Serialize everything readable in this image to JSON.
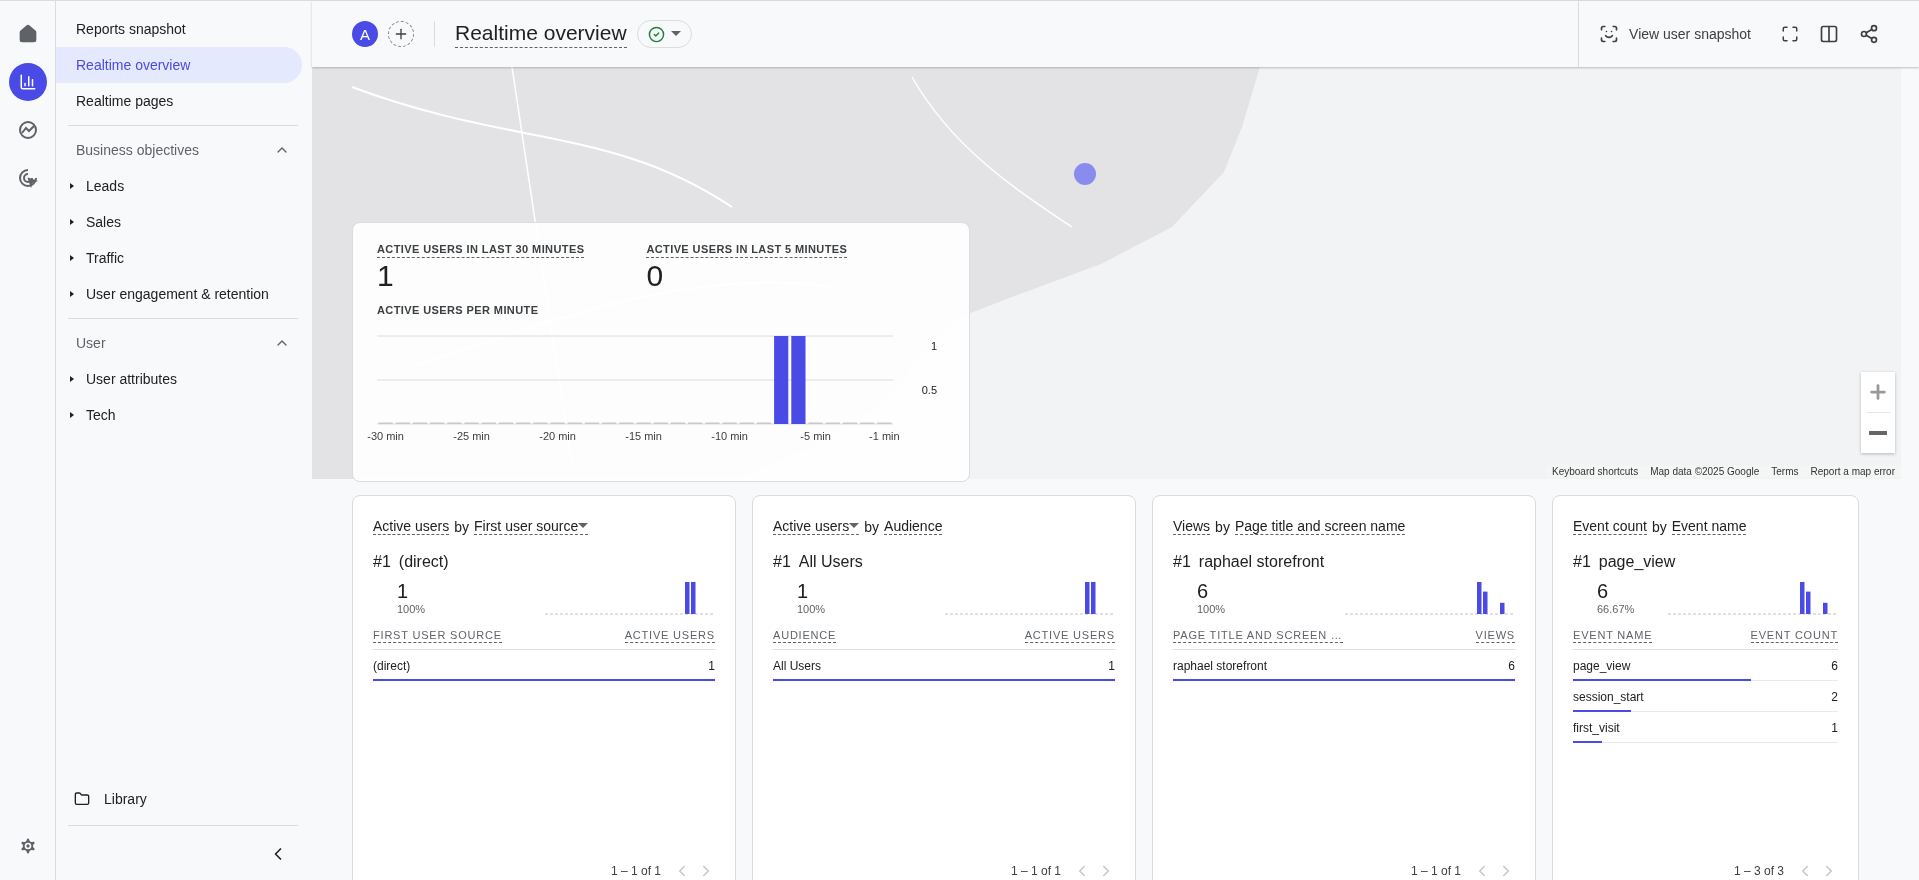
{
  "rail": {
    "items": [
      {
        "kind": "home",
        "selected": false
      },
      {
        "kind": "reports",
        "selected": true
      },
      {
        "kind": "explore",
        "selected": false
      },
      {
        "kind": "advertising",
        "selected": false
      }
    ]
  },
  "sidebar": {
    "items": [
      {
        "label": "Reports snapshot",
        "selected": false
      },
      {
        "label": "Realtime overview",
        "selected": true
      },
      {
        "label": "Realtime pages",
        "selected": false
      }
    ],
    "sections": [
      {
        "title": "Business objectives",
        "expanded": true,
        "children": [
          {
            "label": "Leads",
            "expanded": false
          },
          {
            "label": "Sales",
            "expanded": false
          },
          {
            "label": "Traffic",
            "expanded": false
          },
          {
            "label": "User engagement & retention",
            "expanded": false
          }
        ]
      },
      {
        "title": "User",
        "expanded": true,
        "children": [
          {
            "label": "User attributes",
            "expanded": false
          },
          {
            "label": "Tech",
            "expanded": false
          }
        ]
      }
    ],
    "library": "Library"
  },
  "header": {
    "avatar": "A",
    "title": "Realtime overview",
    "snapshot_button": "View user snapshot"
  },
  "map": {
    "kind": "picture",
    "attribution": [
      "Keyboard shortcuts",
      "Map data ©2025 Google",
      "Terms",
      "Report a map error"
    ]
  },
  "summary": {
    "metrics": [
      {
        "label": "ACTIVE USERS IN LAST 30 MINUTES",
        "value": "1"
      },
      {
        "label": "ACTIVE USERS IN LAST 5 MINUTES",
        "value": "0"
      }
    ],
    "chart_data": {
      "type": "bar",
      "title": "ACTIVE USERS PER MINUTE",
      "x": [
        -30,
        -29,
        -28,
        -27,
        -26,
        -25,
        -24,
        -23,
        -22,
        -21,
        -20,
        -19,
        -18,
        -17,
        -16,
        -15,
        -14,
        -13,
        -12,
        -11,
        -10,
        -9,
        -8,
        -7,
        -6,
        -5,
        -4,
        -3,
        -2,
        -1
      ],
      "values": [
        0,
        0,
        0,
        0,
        0,
        0,
        0,
        0,
        0,
        0,
        0,
        0,
        0,
        0,
        0,
        0,
        0,
        0,
        0,
        0,
        0,
        0,
        0,
        1,
        1,
        0,
        0,
        0,
        0,
        0
      ],
      "xticks": [
        {
          "value": -30,
          "label": "-30 min"
        },
        {
          "value": -25,
          "label": "-25 min"
        },
        {
          "value": -20,
          "label": "-20 min"
        },
        {
          "value": -15,
          "label": "-15 min"
        },
        {
          "value": -10,
          "label": "-10 min"
        },
        {
          "value": -5,
          "label": "-5 min"
        },
        {
          "value": -1,
          "label": "-1 min"
        }
      ],
      "xlim": [
        -30.5,
        -0.5
      ],
      "ylim": [
        0,
        1
      ],
      "yticks": [
        0.5,
        1
      ]
    }
  },
  "cards": [
    {
      "metric": "Active users",
      "metric_dropdown": false,
      "joiner": "by",
      "dimension": "First user source",
      "dimension_dropdown": true,
      "rank": "#1",
      "top_name": "(direct)",
      "top_value": "1",
      "top_share": "100%",
      "columns": [
        "FIRST USER SOURCE",
        "ACTIVE USERS"
      ],
      "rows": [
        {
          "name": "(direct)",
          "value": "1",
          "level": 1
        }
      ],
      "pagination": "1 – 1 of 1",
      "prev_disabled": true,
      "next_disabled": true
    },
    {
      "metric": "Active users",
      "metric_dropdown": true,
      "joiner": "by",
      "dimension": "Audience",
      "dimension_dropdown": false,
      "rank": "#1",
      "top_name": "All Users",
      "top_value": "1",
      "top_share": "100%",
      "columns": [
        "AUDIENCE",
        "ACTIVE USERS"
      ],
      "rows": [
        {
          "name": "All Users",
          "value": "1",
          "level": 1
        }
      ],
      "pagination": "1 – 1 of 1",
      "prev_disabled": true,
      "next_disabled": true
    },
    {
      "metric": "Views",
      "metric_dropdown": false,
      "joiner": "by",
      "dimension": "Page title and screen name",
      "dimension_dropdown": false,
      "rank": "#1",
      "top_name": "raphael storefront",
      "top_value": "6",
      "top_share": "100%",
      "columns": [
        "PAGE TITLE AND SCREEN …",
        "VIEWS"
      ],
      "rows": [
        {
          "name": "raphael storefront",
          "value": "6",
          "level": 1
        }
      ],
      "pagination": "1 – 1 of 1",
      "prev_disabled": true,
      "next_disabled": true
    },
    {
      "metric": "Event count",
      "metric_dropdown": false,
      "joiner": "by",
      "dimension": "Event name",
      "dimension_dropdown": false,
      "rank": "#1",
      "top_name": "page_view",
      "top_value": "6",
      "top_share": "66.67%",
      "columns": [
        "EVENT NAME",
        "EVENT COUNT"
      ],
      "rows": [
        {
          "name": "page_view",
          "value": "6",
          "level": 0.67
        },
        {
          "name": "session_start",
          "value": "2",
          "level": 0.22
        },
        {
          "name": "first_visit",
          "value": "1",
          "level": 0.11
        }
      ],
      "pagination": "1 – 3 of 3",
      "prev_disabled": true,
      "next_disabled": true
    }
  ]
}
